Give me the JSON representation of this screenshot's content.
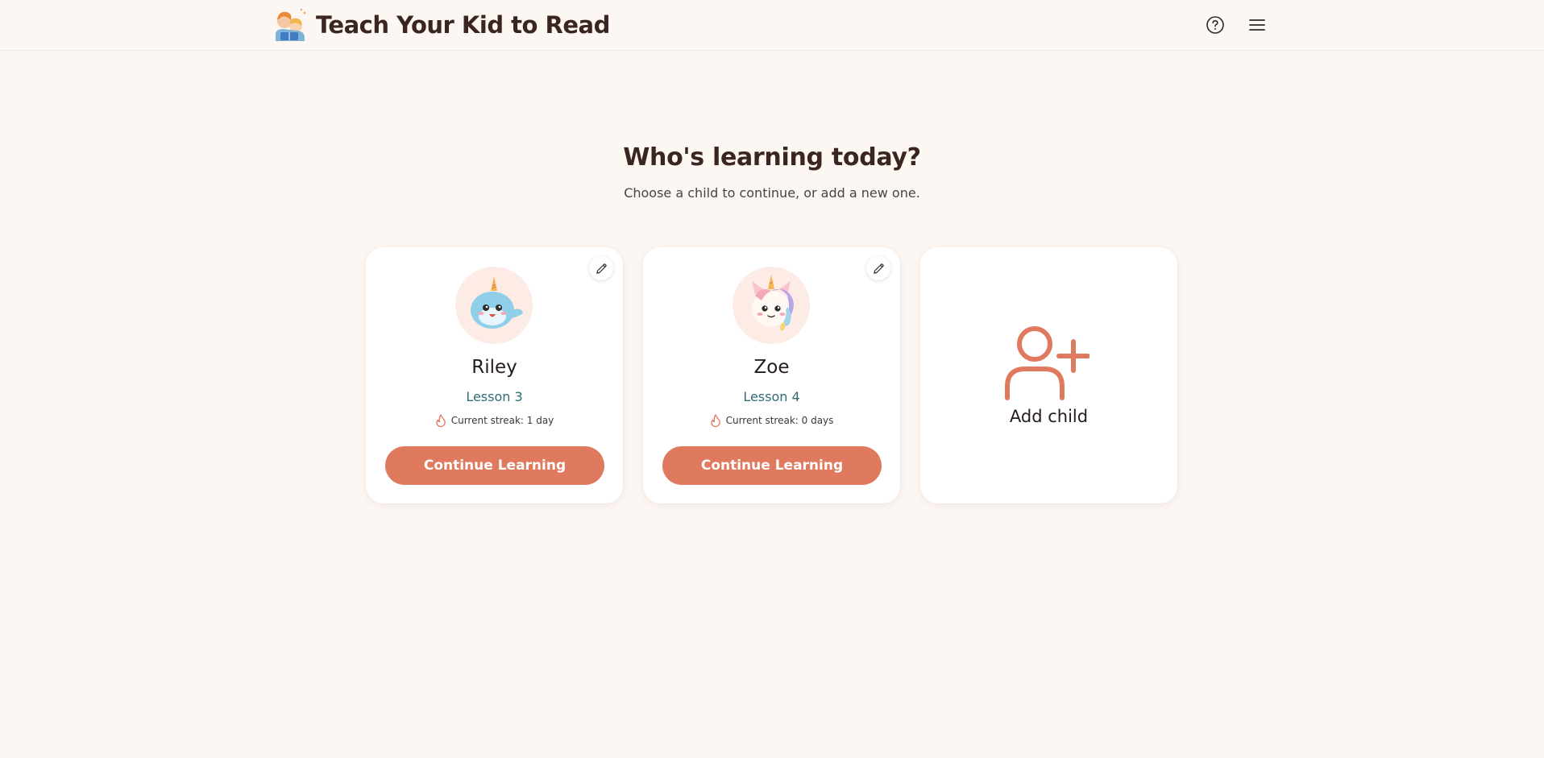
{
  "header": {
    "title": "Teach Your Kid to Read",
    "icons": [
      "help-circle-icon",
      "hamburger-menu-icon"
    ]
  },
  "main": {
    "heading": "Who's learning today?",
    "subheading": "Choose a child to continue, or add a new one."
  },
  "children": [
    {
      "name": "Riley",
      "lesson": "Lesson 3",
      "streak": "Current streak: 1 day",
      "avatar": "narwhal-avatar",
      "button": "Continue Learning"
    },
    {
      "name": "Zoe",
      "lesson": "Lesson 4",
      "streak": "Current streak: 0 days",
      "avatar": "unicorn-avatar",
      "button": "Continue Learning"
    }
  ],
  "add_child": {
    "label": "Add child",
    "icon": "add-user-icon"
  },
  "colors": {
    "background": "#fdf7f3",
    "accent": "#df7a5f",
    "lesson_text": "#2f6b73",
    "heading": "#3a2520"
  }
}
